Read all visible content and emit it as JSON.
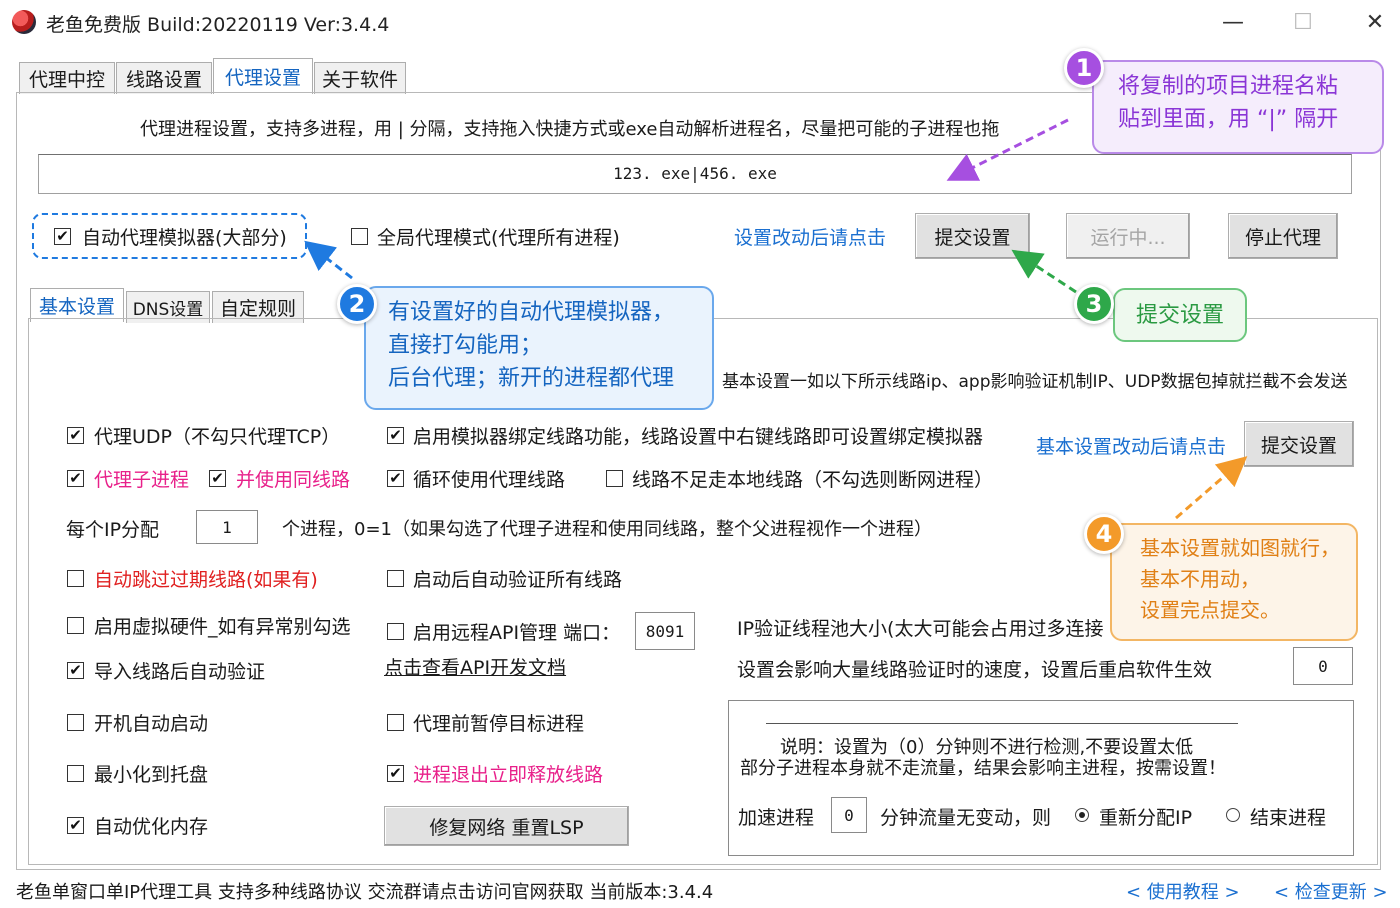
{
  "window": {
    "title": "老鱼免费版 Build:20220119 Ver:3.4.4",
    "minimize": "—",
    "maximize": "☐",
    "close": "✕"
  },
  "tabs": [
    "代理中控",
    "线路设置",
    "代理设置",
    "关于软件"
  ],
  "desc_line": "代理进程设置，支持多进程，用 | 分隔，支持拖入快捷方式或exe自动解析进程名，尽量把可能的子进程也拖",
  "process_input": "123. exe|456. exe",
  "top_row": {
    "auto_emulator": "自动代理模拟器(大部分)",
    "global_mode": "全局代理模式(代理所有进程)",
    "settings_link": "设置改动后请点击",
    "submit": "提交设置",
    "running": "运行中...",
    "stop": "停止代理"
  },
  "sub_tabs": [
    "基本设置",
    "DNS设置",
    "自定规则"
  ],
  "basic_desc": "基本设置一如以下所示线路ip、app影响验证机制IP、UDP数据包掉就拦截不会发送",
  "options": {
    "proxy_udp": "代理UDP（不勾只代理TCP）",
    "bind_emulator": "启用模拟器绑定线路功能，线路设置中右键线路即可设置绑定模拟器",
    "basic_link": "基本设置改动后请点击",
    "basic_submit": "提交设置",
    "proxy_child": "代理子进程",
    "same_line": "并使用同线路",
    "loop_lines": "循环使用代理线路",
    "local_fallback": "线路不足走本地线路（不勾选则断网进程）",
    "per_ip_label": "每个IP分配",
    "per_ip_value": "1",
    "per_ip_desc": "个进程，0=1（如果勾选了代理子进程和使用同线路，整个父进程视作一个进程）",
    "skip_expired": "自动跳过过期线路(如果有)",
    "verify_all": "启动后自动验证所有线路",
    "virtual_hw": "启用虚拟硬件_如有异常别勾选",
    "remote_api": "启用远程API管理 端口：",
    "api_port": "8091",
    "ip_pool": "IP验证线程池大小(太大可能会占用过多连接",
    "auto_verify": "导入线路后自动验证",
    "api_doc": "点击查看API开发文档",
    "speed_note": "设置会影响大量线路验证时的速度，设置后重启软件生效",
    "speed_value": "0",
    "autostart": "开机自动启动",
    "pause_target": "代理前暂停目标进程",
    "min_tray": "最小化到托盘",
    "release_line": "进程退出立即释放线路",
    "optimize_mem": "自动优化内存",
    "repair_net": "修复网络 重置LSP"
  },
  "note": {
    "line1": "说明：设置为（0）分钟则不进行检测,不要设置太低",
    "line2": "部分子进程本身就不走流量，结果会影响主进程，按需设置！",
    "accel_label": "加速进程",
    "accel_value": "0",
    "accel_desc": "分钟流量无变动，则",
    "realloc": "重新分配IP",
    "end_proc": "结束进程"
  },
  "footer": {
    "text": "老鱼单窗口单IP代理工具 支持多种线路协议 交流群请点击访问官网获取   当前版本:3.4.4",
    "tutorial": "< 使用教程 >",
    "update": "< 检查更新 >"
  },
  "callouts": {
    "c1": {
      "num": "1",
      "line1": "将复制的项目进程名粘",
      "line2": "贴到里面，用 “|” 隔开"
    },
    "c2": {
      "num": "2",
      "line1": "有设置好的自动代理模拟器，",
      "line2": "直接打勾能用；",
      "line3": "后台代理；新开的进程都代理"
    },
    "c3": {
      "num": "3",
      "line1": "提交设置"
    },
    "c4": {
      "num": "4",
      "line1": "基本设置就如图就行，",
      "line2": "基本不用动，",
      "line3": "设置完点提交。"
    }
  },
  "colors": {
    "purple": "#a64fe0",
    "blue": "#1f7ae0",
    "green": "#2ea84a",
    "orange": "#f39a2a",
    "link": "#1a6fd0",
    "pink": "#e8208a"
  }
}
